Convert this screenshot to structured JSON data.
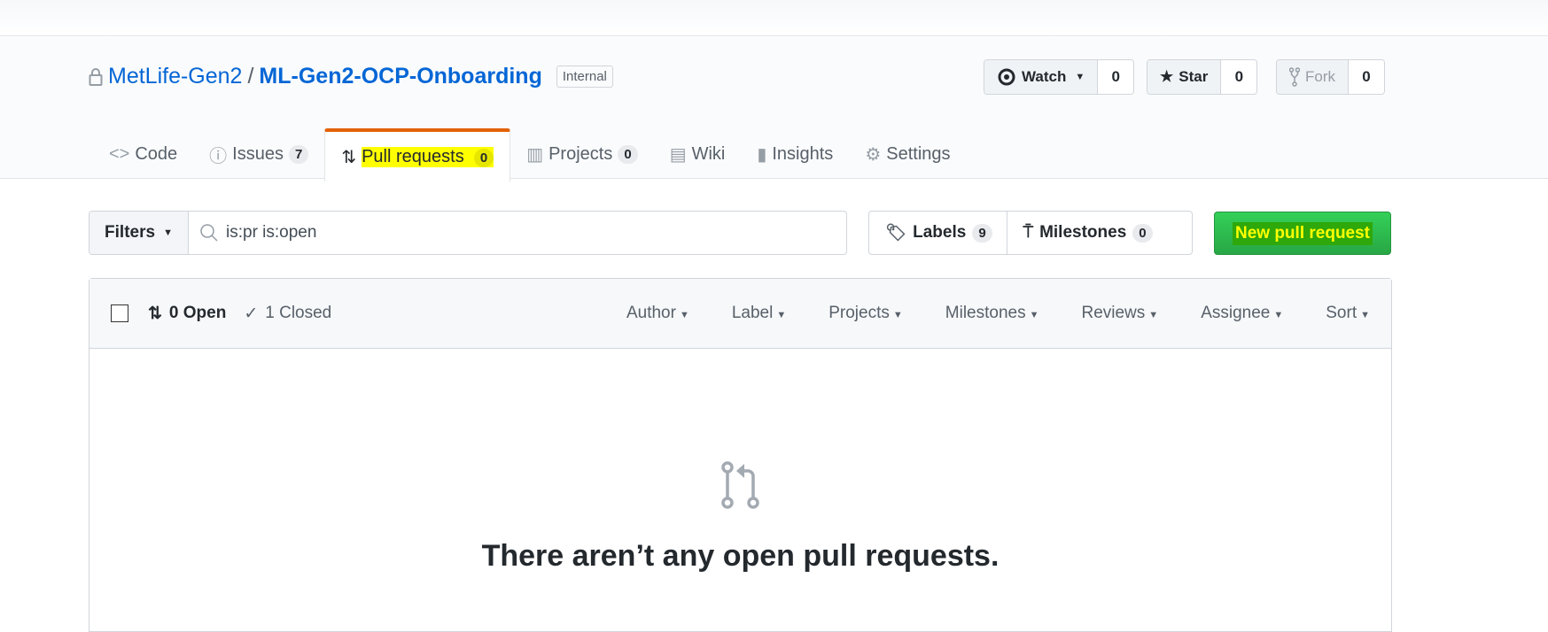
{
  "repo": {
    "owner": "MetLife-Gen2",
    "separator": "/",
    "name": "ML-Gen2-OCP-Onboarding",
    "visibility": "Internal"
  },
  "actions": [
    {
      "label": "Watch",
      "count": "0",
      "icon": "eye-icon"
    },
    {
      "label": "Star",
      "count": "0",
      "icon": "star-icon"
    },
    {
      "label": "Fork",
      "count": "0",
      "icon": "fork-icon"
    }
  ],
  "tabs": [
    {
      "label": "Code"
    },
    {
      "label": "Issues",
      "count": "7"
    },
    {
      "label": "Pull requests",
      "count": "0",
      "selected": true
    },
    {
      "label": "Projects",
      "count": "0"
    },
    {
      "label": "Wiki"
    },
    {
      "label": "Insights"
    },
    {
      "label": "Settings"
    }
  ],
  "filters": {
    "label": "Filters",
    "query": "is:pr is:open"
  },
  "labels": {
    "label": "Labels",
    "count": "9"
  },
  "milestones": {
    "label": "Milestones",
    "count": "0"
  },
  "new_pr": "New pull request",
  "list": {
    "open": "0 Open",
    "closed": "1 Closed",
    "menus": [
      "Author",
      "Label",
      "Projects",
      "Milestones",
      "Reviews",
      "Assignee",
      "Sort"
    ]
  },
  "empty": {
    "message": "There aren’t any open pull requests."
  },
  "colors": {
    "accent": "#0366d6",
    "tab_underline": "#e36209",
    "new_pr_bg": "#28a745",
    "highlight": "#ffff00"
  }
}
